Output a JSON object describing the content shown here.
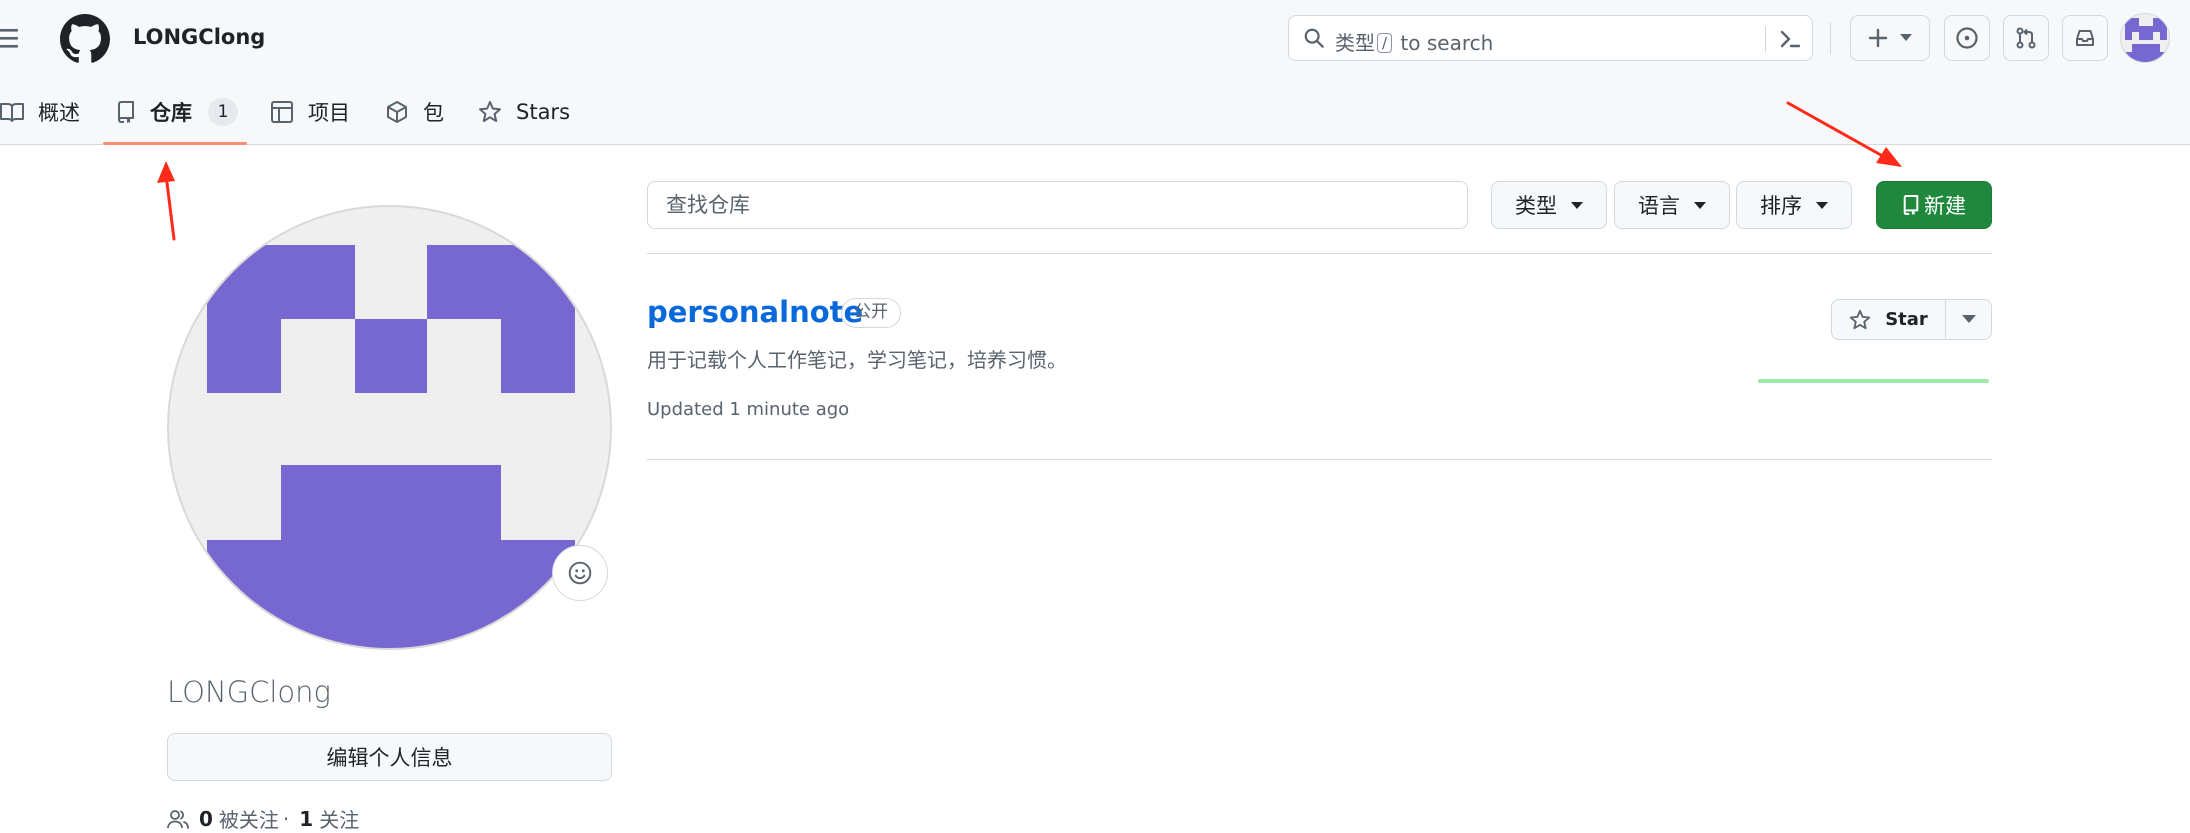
{
  "header": {
    "username": "LONGClong",
    "search_placeholder_prefix": "类型",
    "search_shortcut_key": "/",
    "search_placeholder_suffix": "to search",
    "icons": [
      "hamburger-icon",
      "github-logo-icon",
      "search-icon",
      "command-palette-icon",
      "plus-icon",
      "chevron-down-icon",
      "issues-icon",
      "pull-requests-icon",
      "inbox-icon"
    ]
  },
  "tabs": [
    {
      "label": "概述",
      "icon": "book-icon"
    },
    {
      "label": "仓库",
      "icon": "repo-icon",
      "count": "1",
      "selected": true
    },
    {
      "label": "项目",
      "icon": "table-icon"
    },
    {
      "label": "包",
      "icon": "package-icon"
    },
    {
      "label": "Stars",
      "icon": "star-icon"
    }
  ],
  "profile": {
    "name": "LONGClong",
    "edit_button": "编辑个人信息",
    "followers_count": "0",
    "followers_label": "被关注",
    "separator": "·",
    "following_count": "1",
    "following_label": "关注"
  },
  "filters": {
    "search_placeholder": "查找仓库",
    "type_label": "类型",
    "language_label": "语言",
    "sort_label": "排序",
    "new_button": "新建"
  },
  "repos": [
    {
      "name": "personalnote",
      "visibility": "公开",
      "description": "用于记载个人工作笔记，学习笔记，培养习惯。",
      "updated": "Updated 1 minute ago",
      "star_label": "Star"
    }
  ],
  "colors": {
    "accent_green": "#1f883d",
    "link_blue": "#0969da",
    "tab_underline": "#fd8c73",
    "avatar_purple": "#7667d1",
    "annotation_arrow": "#ff2a1a"
  }
}
